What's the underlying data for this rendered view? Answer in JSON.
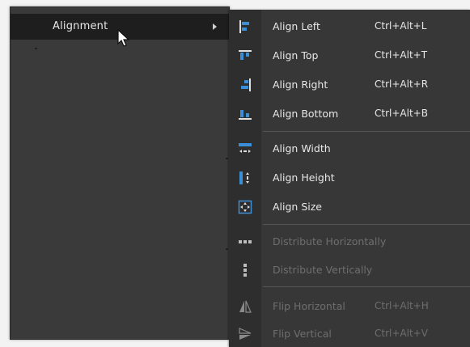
{
  "parent_menu": {
    "alignment_label": "Alignment"
  },
  "submenu": {
    "items": [
      {
        "label": "Align Left",
        "shortcut": "Ctrl+Alt+L",
        "icon": "align-left-icon",
        "enabled": true
      },
      {
        "label": "Align Top",
        "shortcut": "Ctrl+Alt+T",
        "icon": "align-top-icon",
        "enabled": true
      },
      {
        "label": "Align Right",
        "shortcut": "Ctrl+Alt+R",
        "icon": "align-right-icon",
        "enabled": true
      },
      {
        "label": "Align Bottom",
        "shortcut": "Ctrl+Alt+B",
        "icon": "align-bottom-icon",
        "enabled": true
      },
      {
        "label": "Align Width",
        "shortcut": "",
        "icon": "align-width-icon",
        "enabled": true
      },
      {
        "label": "Align Height",
        "shortcut": "",
        "icon": "align-height-icon",
        "enabled": true
      },
      {
        "label": "Align Size",
        "shortcut": "",
        "icon": "align-size-icon",
        "enabled": true
      },
      {
        "label": "Distribute Horizontally",
        "shortcut": "",
        "icon": "distribute-horizontal-icon",
        "enabled": false
      },
      {
        "label": "Distribute Vertically",
        "shortcut": "",
        "icon": "distribute-vertical-icon",
        "enabled": false
      },
      {
        "label": "Flip Horizontal",
        "shortcut": "Ctrl+Alt+H",
        "icon": "flip-horizontal-icon",
        "enabled": false
      },
      {
        "label": "Flip Vertical",
        "shortcut": "Ctrl+Alt+V",
        "icon": "flip-vertical-icon",
        "enabled": false
      }
    ]
  },
  "colors": {
    "menu_background": "#373737",
    "icon_accent": "#3c8fd6",
    "enabled_text": "#e8e8e8",
    "disabled_text": "#6e6e6e"
  }
}
